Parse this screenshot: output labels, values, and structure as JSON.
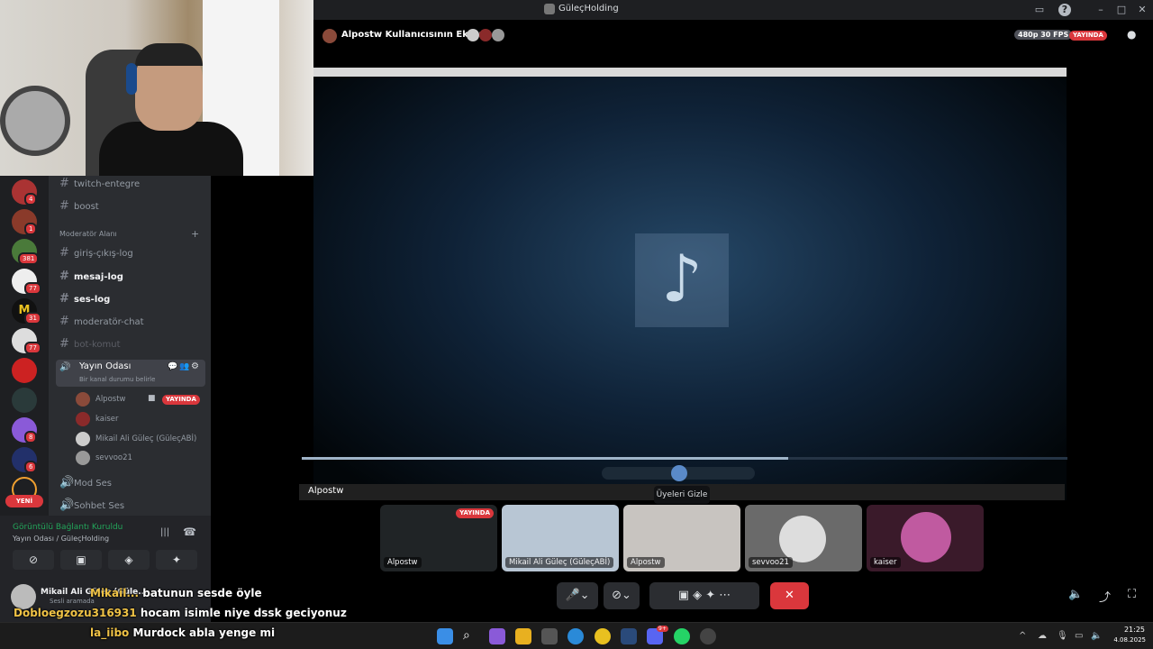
{
  "window": {
    "title": "GüleçHolding",
    "controls": [
      "inbox-icon",
      "help-icon",
      "minimize",
      "maximize",
      "close"
    ]
  },
  "stream": {
    "header_title": "Alpostw Kullanıcısının Ekranı",
    "quality": "480p 30 FPS",
    "live_badge": "YAYINDA",
    "screen_label": "Alpostw",
    "tooltip": "Üyeleri Gizle"
  },
  "server_badges": [
    "4",
    "1",
    "381",
    "77",
    "31",
    "77",
    "8",
    "6"
  ],
  "new_badge": "YENİ",
  "channels": {
    "text": [
      {
        "name": "twitch-entegre",
        "style": "normal"
      },
      {
        "name": "boost",
        "style": "normal"
      }
    ],
    "category": "Moderatör Alanı",
    "mod": [
      {
        "name": "giriş-çıkış-log",
        "style": "normal"
      },
      {
        "name": "mesaj-log",
        "style": "bright"
      },
      {
        "name": "ses-log",
        "style": "bright"
      },
      {
        "name": "moderatör-chat",
        "style": "normal"
      },
      {
        "name": "bot-komut",
        "style": "dim"
      }
    ],
    "voice_room": {
      "name": "Yayın Odası",
      "status_placeholder": "Bir kanal durumu belirle"
    },
    "voice_users": [
      {
        "name": "Alpostw",
        "live": "YAYINDA"
      },
      {
        "name": "kaiser"
      },
      {
        "name": "Mikail Ali Güleç (GüleçABİ)"
      },
      {
        "name": "sevvoo21"
      }
    ],
    "voice_channels": [
      "Mod Ses",
      "Sohbet Ses"
    ]
  },
  "connection": {
    "status": "Görüntülü Bağlantı Kuruldu",
    "location": "Yayın Odası / GüleçHolding"
  },
  "user": {
    "name": "Mikail Ali Güleç (Güle...",
    "status": "Sesli aramada"
  },
  "tiles": [
    {
      "name": "Alpostw",
      "live": "YAYINDA"
    },
    {
      "name": "Mikail Ali Güleç (GüleçABİ)"
    },
    {
      "name": "Alpostw"
    },
    {
      "name": "sevvoo21"
    },
    {
      "name": "kaiser"
    }
  ],
  "chat": [
    {
      "user": "Mikail...",
      "text": "batunun sesde öyle"
    },
    {
      "user": "Dobloegzozu316931",
      "text": "hocam isimle niye dssk geciyonuz"
    },
    {
      "user": "la_iibo",
      "text": "Murdock abla yenge mi"
    }
  ],
  "taskbar": {
    "time": "21:25",
    "date": "4.08.2025",
    "discord_badge": "9+"
  }
}
